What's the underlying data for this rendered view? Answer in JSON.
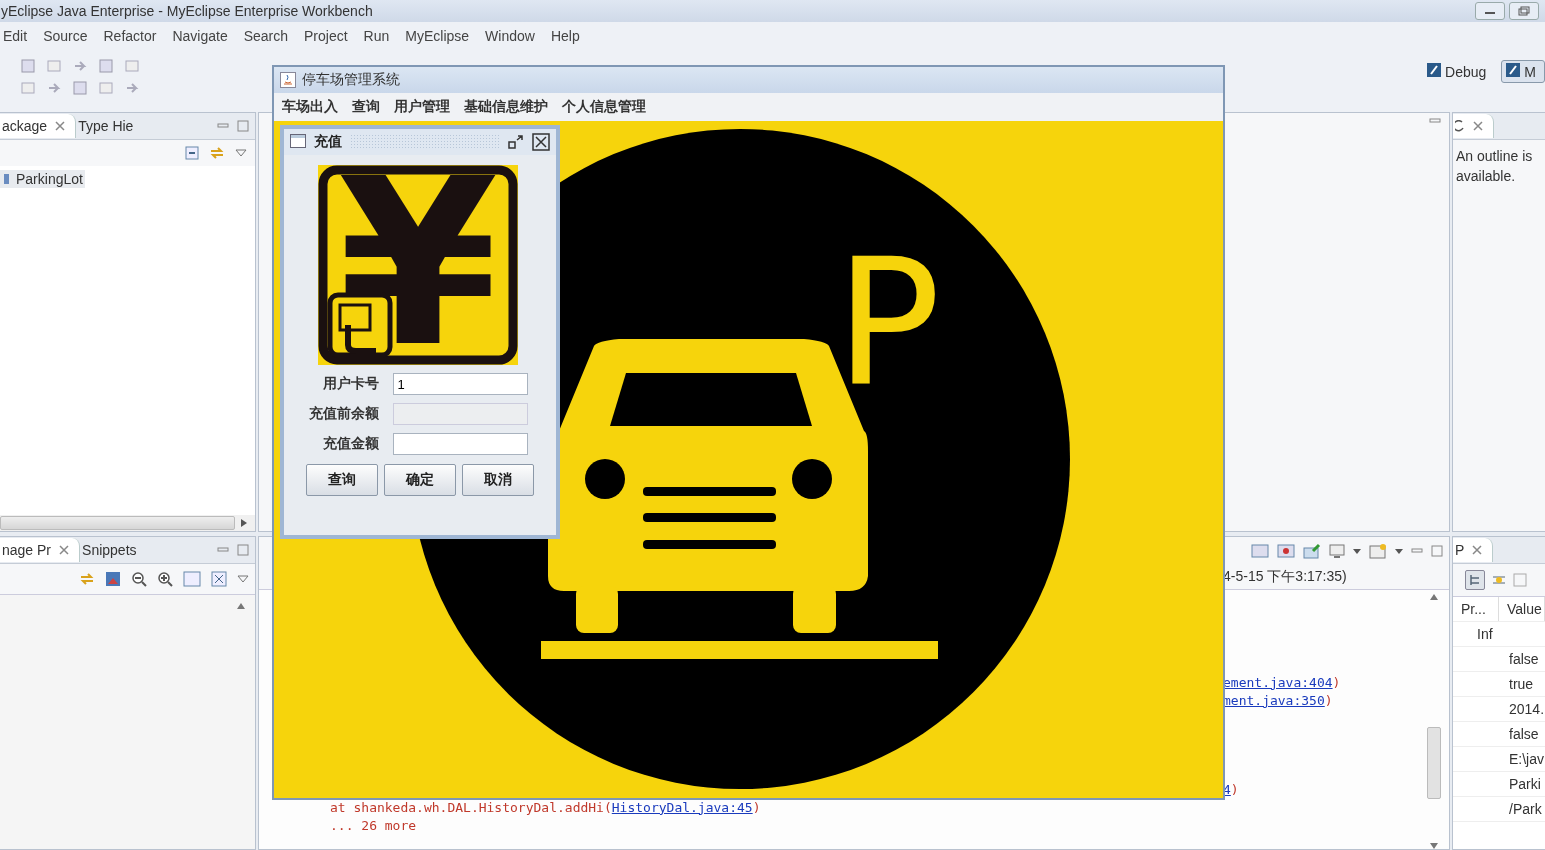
{
  "window": {
    "title": "yEclipse Java Enterprise - MyEclipse Enterprise Workbench"
  },
  "menu": [
    "Edit",
    "Source",
    "Refactor",
    "Navigate",
    "Search",
    "Project",
    "Run",
    "MyEclipse",
    "Window",
    "Help"
  ],
  "perspectives": [
    {
      "label": "Debug",
      "selected": false
    },
    {
      "label": "M",
      "selected": true
    }
  ],
  "package_explorer": {
    "tabs": [
      {
        "label": "ackage",
        "selected": true,
        "closable": true
      },
      {
        "label": "Type Hie",
        "selected": false,
        "closable": false
      }
    ],
    "tree": [
      {
        "label": "ParkingLot",
        "selected": true
      }
    ]
  },
  "image_panel": {
    "tabs": [
      {
        "label": "nage Pr",
        "selected": true,
        "closable": true
      },
      {
        "label": "Snippets",
        "selected": false,
        "closable": false
      }
    ]
  },
  "outline": {
    "message": "An outline is available."
  },
  "console": {
    "header": "4-5-15 下午3:17:35)",
    "lines": [
      {
        "parts": [
          {
            "kind": "link",
            "text": "ement.java:404"
          },
          {
            "kind": "text",
            "text": ")"
          }
        ]
      },
      {
        "parts": [
          {
            "kind": "link",
            "text": "ment.java:350"
          },
          {
            "kind": "text",
            "text": ")"
          }
        ]
      },
      {
        "parts": [
          {
            "kind": "link",
            "text": "4"
          },
          {
            "kind": "text",
            "text": ")"
          }
        ]
      },
      {
        "parts": [
          {
            "kind": "text",
            "text": "at shankeda.wh.DAL.HistoryDal.addHi("
          },
          {
            "kind": "link",
            "text": "HistoryDal.java:45"
          },
          {
            "kind": "text",
            "text": ")"
          }
        ]
      },
      {
        "parts": [
          {
            "kind": "text",
            "text": "... 26 more"
          }
        ]
      }
    ]
  },
  "properties": {
    "tab": "P",
    "columns": [
      "Pr...",
      "Value"
    ],
    "rows": [
      {
        "property": "Inf"
      },
      {
        "value": "false"
      },
      {
        "value": "true"
      },
      {
        "value": "2014."
      },
      {
        "value": "false"
      },
      {
        "value": "E:\\jav"
      },
      {
        "value": "Parki"
      },
      {
        "value": "/Park"
      }
    ]
  },
  "app": {
    "title": "停车场管理系统",
    "menu": [
      "车场出入",
      "查询",
      "用户管理",
      "基础信息维护",
      "个人信息管理"
    ],
    "sign_letter": "P"
  },
  "dialog": {
    "title": "充值",
    "glyph": "¥",
    "fields": [
      {
        "label": "用户卡号",
        "value": "1",
        "disabled": false
      },
      {
        "label": "充值前余额",
        "disabled": true
      },
      {
        "label": "充值金额",
        "disabled": false
      }
    ],
    "buttons": [
      "查询",
      "确定",
      "取消"
    ]
  }
}
